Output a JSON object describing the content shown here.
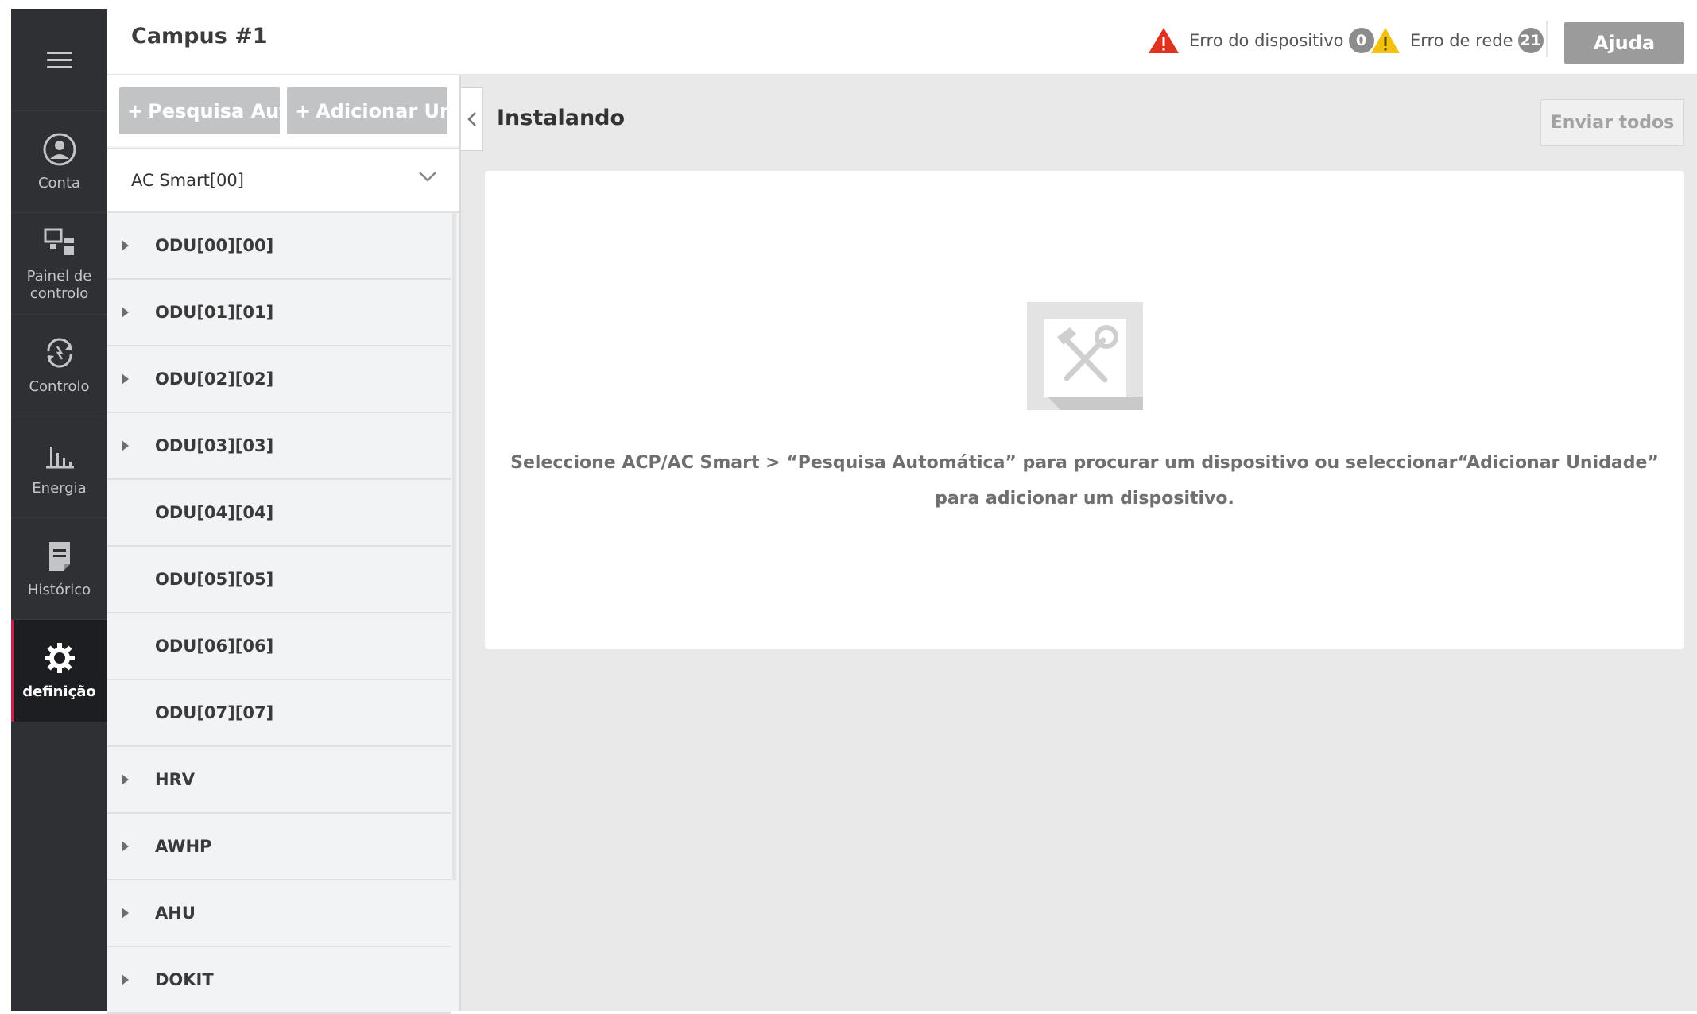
{
  "sidebar": {
    "menu_icon": "hamburger-icon",
    "items": [
      {
        "label": "Conta",
        "icon": "account-icon",
        "active": false
      },
      {
        "label": "Painel de controlo",
        "icon": "dashboard-icon",
        "active": false
      },
      {
        "label": "Controlo",
        "icon": "control-icon",
        "active": false
      },
      {
        "label": "Energia",
        "icon": "energy-chart-icon",
        "active": false
      },
      {
        "label": "Histórico",
        "icon": "history-icon",
        "active": false
      },
      {
        "label": "definição",
        "icon": "gear-icon",
        "active": true
      }
    ],
    "active_accent": "#c9204f"
  },
  "header": {
    "title": "Campus #1",
    "device_error_label": "Erro do dispositivo",
    "device_error_count": "0",
    "network_error_label": "Erro de rede",
    "network_error_count": "21",
    "help_label": "Ajuda",
    "device_error_color": "#e0321f",
    "network_error_color": "#f4c20d"
  },
  "tree": {
    "auto_search_label": "Pesquisa Aut···",
    "add_unit_label": "Adicionar Uni···",
    "root": "AC Smart[00]",
    "rows": [
      {
        "label": "ODU[00][00]",
        "expandable": true
      },
      {
        "label": "ODU[01][01]",
        "expandable": true
      },
      {
        "label": "ODU[02][02]",
        "expandable": true
      },
      {
        "label": "ODU[03][03]",
        "expandable": true
      },
      {
        "label": "ODU[04][04]",
        "expandable": false
      },
      {
        "label": "ODU[05][05]",
        "expandable": false
      },
      {
        "label": "ODU[06][06]",
        "expandable": false
      },
      {
        "label": "ODU[07][07]",
        "expandable": false
      },
      {
        "label": "HRV",
        "expandable": true
      },
      {
        "label": "AWHP",
        "expandable": true
      },
      {
        "label": "AHU",
        "expandable": true
      },
      {
        "label": "DOKIT",
        "expandable": true
      }
    ]
  },
  "content": {
    "title": "Instalando",
    "send_all_label": "Enviar todos",
    "empty_icon": "tools-icon",
    "empty_message_line1": "Seleccione ACP/AC Smart > “Pesquisa Automática” para procurar um dispositivo ou seleccionar“Adicionar Unidade”",
    "empty_message_line2": "para adicionar um dispositivo."
  }
}
